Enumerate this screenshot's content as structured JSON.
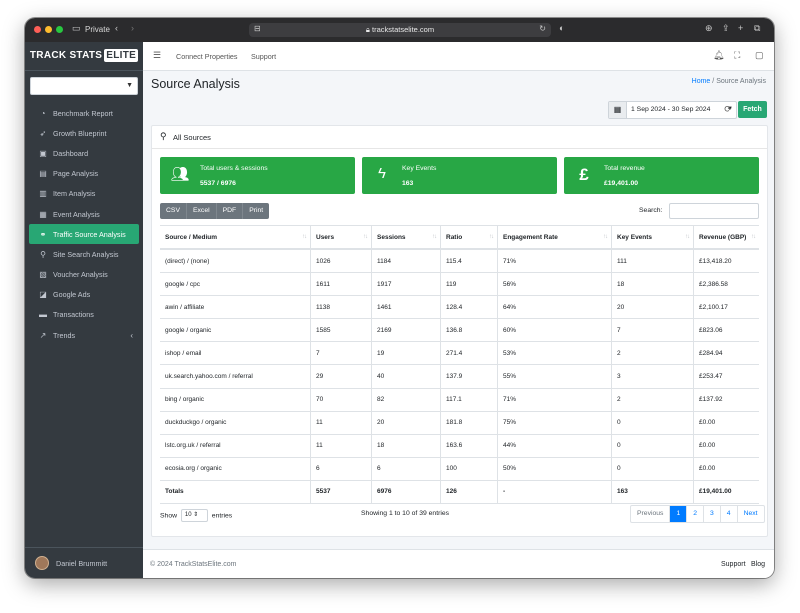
{
  "browser": {
    "private_label": "Private",
    "url": "trackstatselite.com"
  },
  "brand": {
    "name": "TRACK STATS",
    "badge": "ELITE"
  },
  "sidebar": {
    "items": [
      {
        "label": "Benchmark Report",
        "icon": "gauge-icon"
      },
      {
        "label": "Growth Blueprint",
        "icon": "rocket-icon"
      },
      {
        "label": "Dashboard",
        "icon": "dashboard-icon"
      },
      {
        "label": "Page Analysis",
        "icon": "file-icon"
      },
      {
        "label": "Item Analysis",
        "icon": "chart-icon"
      },
      {
        "label": "Event Analysis",
        "icon": "calendar-icon"
      },
      {
        "label": "Traffic Source Analysis",
        "icon": "link-icon",
        "active": true
      },
      {
        "label": "Site Search Analysis",
        "icon": "search-icon"
      },
      {
        "label": "Voucher Analysis",
        "icon": "ticket-icon"
      },
      {
        "label": "Google Ads",
        "icon": "ads-icon"
      },
      {
        "label": "Transactions",
        "icon": "card-icon"
      },
      {
        "label": "Trends",
        "icon": "trend-icon"
      }
    ],
    "user": "Daniel Brummitt"
  },
  "topbar": {
    "connect": "Connect Properties",
    "support": "Support"
  },
  "page": {
    "title": "Source Analysis",
    "breadcrumb_home": "Home",
    "breadcrumb_sep": "/",
    "breadcrumb_current": "Source Analysis",
    "date_range": "1 Sep 2024 - 30 Sep 2024",
    "fetch": "Fetch"
  },
  "card": {
    "title": "All Sources"
  },
  "stats": [
    {
      "label": "Total users & sessions",
      "value": "5537 / 6976",
      "icon": "users-icon"
    },
    {
      "label": "Key Events",
      "value": "163",
      "icon": "bolt-icon"
    },
    {
      "label": "Total revenue",
      "value": "£19,401.00",
      "icon": "pound-icon"
    }
  ],
  "buttons": [
    "CSV",
    "Excel",
    "PDF",
    "Print"
  ],
  "search_label": "Search:",
  "table": {
    "headers": [
      "Source / Medium",
      "Users",
      "Sessions",
      "Ratio",
      "Engagement Rate",
      "Key Events",
      "Revenue (GBP)"
    ],
    "rows": [
      [
        "(direct) / (none)",
        "1026",
        "1184",
        "115.4",
        "71%",
        "111",
        "£13,418.20"
      ],
      [
        "google / cpc",
        "1611",
        "1917",
        "119",
        "56%",
        "18",
        "£2,386.58"
      ],
      [
        "awin / affiliate",
        "1138",
        "1461",
        "128.4",
        "64%",
        "20",
        "£2,100.17"
      ],
      [
        "google / organic",
        "1585",
        "2169",
        "136.8",
        "60%",
        "7",
        "£823.06"
      ],
      [
        "ishop / email",
        "7",
        "19",
        "271.4",
        "53%",
        "2",
        "£284.94"
      ],
      [
        "uk.search.yahoo.com / referral",
        "29",
        "40",
        "137.9",
        "55%",
        "3",
        "£253.47"
      ],
      [
        "bing / organic",
        "70",
        "82",
        "117.1",
        "71%",
        "2",
        "£137.92"
      ],
      [
        "duckduckgo / organic",
        "11",
        "20",
        "181.8",
        "75%",
        "0",
        "£0.00"
      ],
      [
        "lstc.org.uk / referral",
        "11",
        "18",
        "163.6",
        "44%",
        "0",
        "£0.00"
      ],
      [
        "ecosia.org / organic",
        "6",
        "6",
        "100",
        "50%",
        "0",
        "£0.00"
      ]
    ],
    "totals": [
      "Totals",
      "5537",
      "6976",
      "126",
      "-",
      "163",
      "£19,401.00"
    ]
  },
  "footer_table": {
    "show": "Show",
    "length": "10",
    "entries": "entries",
    "info": "Showing 1 to 10 of 39 entries",
    "pager": [
      "Previous",
      "1",
      "2",
      "3",
      "4",
      "Next"
    ]
  },
  "footer": {
    "copy": "© 2024 TrackStatsElite.com",
    "support": "Support",
    "blog": "Blog"
  },
  "colors": {
    "accent": "#28a745",
    "sidebar": "#343a40",
    "link": "#007bff"
  }
}
